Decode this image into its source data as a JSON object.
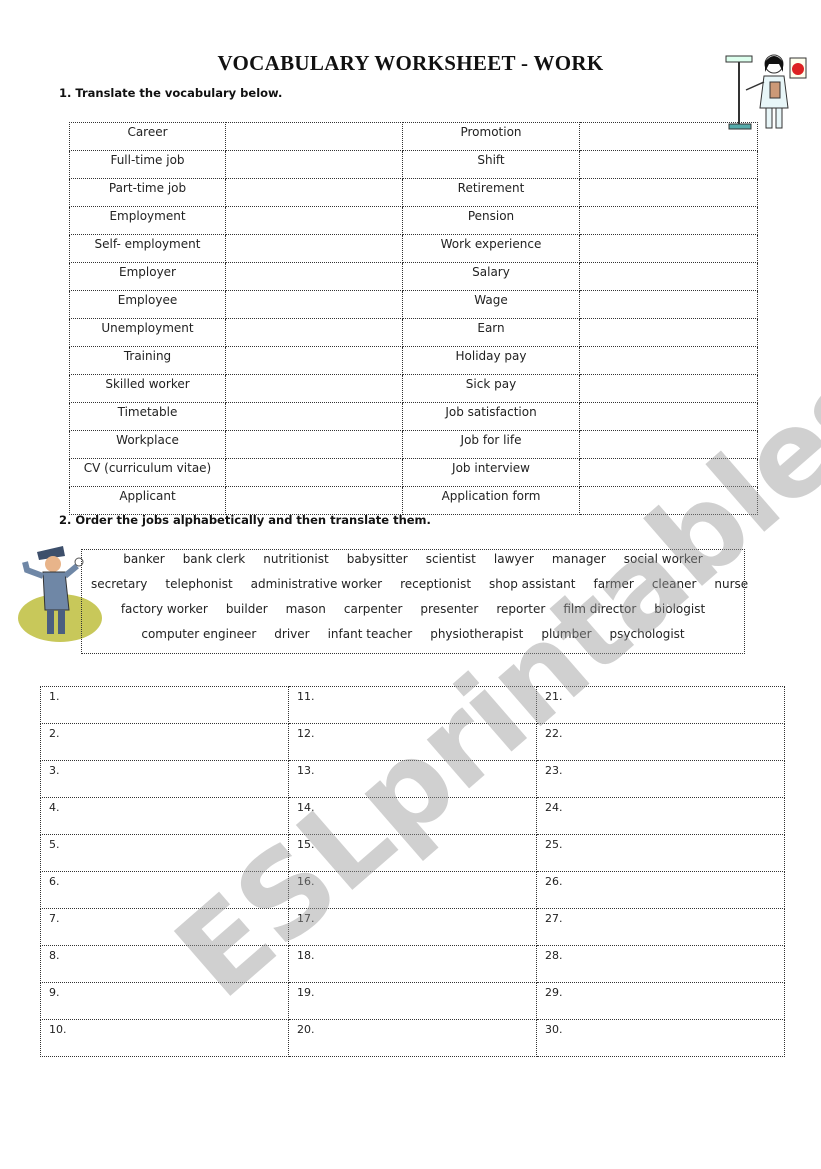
{
  "title": "VOCABULARY WORKSHEET - WORK",
  "section1": {
    "instruction": "1. Translate the vocabulary below.",
    "rows": [
      [
        "Career",
        "Promotion"
      ],
      [
        "Full-time job",
        "Shift"
      ],
      [
        "Part-time job",
        "Retirement"
      ],
      [
        "Employment",
        "Pension"
      ],
      [
        "Self- employment",
        "Work experience"
      ],
      [
        "Employer",
        "Salary"
      ],
      [
        "Employee",
        "Wage"
      ],
      [
        "Unemployment",
        "Earn"
      ],
      [
        "Training",
        "Holiday pay"
      ],
      [
        "Skilled worker",
        "Sick pay"
      ],
      [
        "Timetable",
        "Job satisfaction"
      ],
      [
        "Workplace",
        "Job for life"
      ],
      [
        "CV (curriculum vitae)",
        "Job interview"
      ],
      [
        "Applicant",
        "Application form"
      ]
    ]
  },
  "section2": {
    "instruction": "2. Order the jobs alphabetically and then translate them.",
    "job_lines": [
      [
        "banker",
        "bank clerk",
        "nutritionist",
        "babysitter",
        "scientist",
        "lawyer",
        "manager",
        "social worker"
      ],
      [
        "secretary",
        "telephonist",
        "administrative worker",
        "receptionist",
        "shop assistant",
        "farmer",
        "cleaner",
        "nurse"
      ],
      [
        "factory worker",
        "builder",
        "mason",
        "carpenter",
        "presenter",
        "reporter",
        "film director",
        "biologist"
      ],
      [
        "computer engineer",
        "driver",
        "infant teacher",
        "physiotherapist",
        "plumber",
        "psychologist"
      ]
    ],
    "answer_numbers": [
      [
        "1.",
        "11.",
        "21."
      ],
      [
        "2.",
        "12.",
        "22."
      ],
      [
        "3.",
        "13.",
        "23."
      ],
      [
        "4.",
        "14.",
        "24."
      ],
      [
        "5.",
        "15.",
        "25."
      ],
      [
        "6.",
        "16.",
        "26."
      ],
      [
        "7.",
        "17.",
        "27."
      ],
      [
        "8.",
        "18.",
        "28."
      ],
      [
        "9.",
        "19.",
        "29."
      ],
      [
        "10.",
        "20.",
        "30."
      ]
    ]
  },
  "watermark": "ESLprintables.com"
}
